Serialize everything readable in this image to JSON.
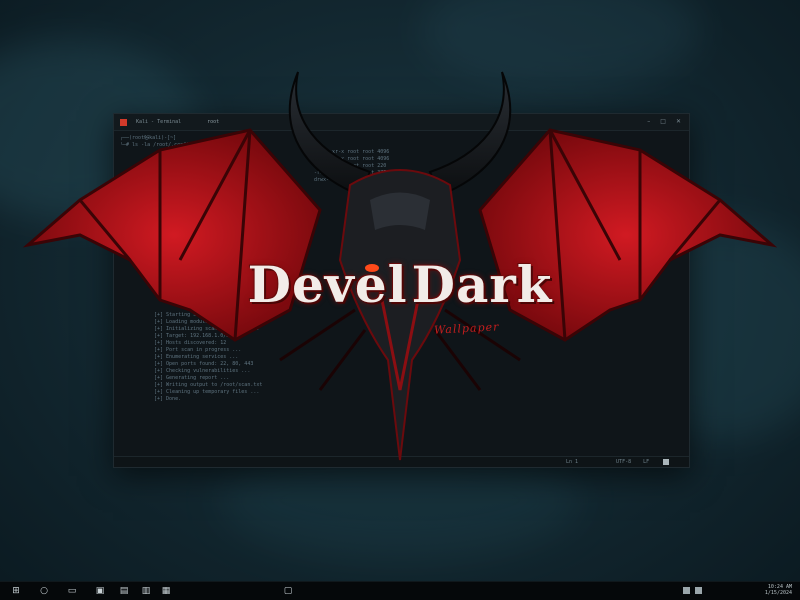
{
  "window": {
    "title": "Kali - Terminal",
    "tab": "root",
    "controls": [
      "–",
      "□",
      "✕"
    ]
  },
  "terminal": {
    "top_lines": [
      "┌──(root㉿kali)-[~]",
      "└─# ls -la /root/.config",
      "drwxr-xr-x  root  root  4096",
      "drwxr-xr-x  root  root  4096",
      "-rw-r--r--  root  root  220",
      "-rw-r--r--  root  root  3771",
      "drwx------  root  root  4096"
    ],
    "bottom_lines": [
      "[+] Starting service ...",
      "[+] Loading modules ...",
      "[+] Initializing scanner engine ...",
      "[+] Target: 192.168.1.0/24",
      "[+] Hosts discovered: 12",
      "[+] Port scan in progress ...",
      "[+] Enumerating services ...",
      "[+] Open ports found: 22, 80, 443",
      "[+] Checking vulnerabilities ...",
      "[+] Generating report ...",
      "[+] Writing output to /root/scan.txt",
      "[+] Cleaning up temporary files ...",
      "[+] Done."
    ]
  },
  "status_bar": {
    "position": "Ln 1",
    "encoding": "UTF-8",
    "mode": "LF"
  },
  "logo": {
    "title_word1": "Devel",
    "title_word2": "Dark",
    "subtitle": "Wallpaper",
    "colors": {
      "wing": "#b5121b",
      "wing_dark": "#4a0608",
      "horn": "#1b1e22",
      "text": "#f2ece8"
    }
  },
  "taskbar": {
    "buttons": [
      "start-icon",
      "search-icon",
      "file-explorer-icon",
      "terminal-icon",
      "settings-icon",
      "browser-icon",
      "app-icon"
    ],
    "tray_line1": "10:24 AM",
    "tray_line2": "1/15/2024"
  }
}
